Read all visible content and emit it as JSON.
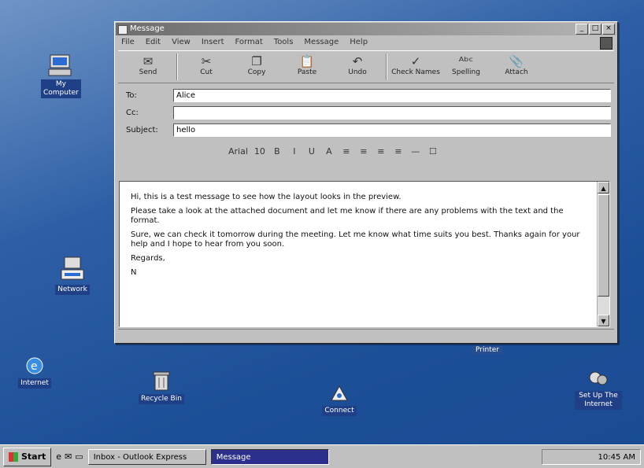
{
  "desktop": {
    "icons": [
      {
        "label": "My Computer",
        "glyph": "computer-icon"
      },
      {
        "label": "Network",
        "glyph": "network-icon"
      },
      {
        "label": "Internet",
        "glyph": "ie-icon"
      },
      {
        "label": "Recycle Bin",
        "glyph": "recycle-bin-icon"
      },
      {
        "label": "Connect",
        "glyph": "dialup-icon"
      },
      {
        "label": "Set Up The Internet",
        "glyph": "setup-icon"
      }
    ],
    "floating_tag": "Printer"
  },
  "window": {
    "title": "Message",
    "menu": [
      "File",
      "Edit",
      "View",
      "Insert",
      "Format",
      "Tools",
      "Message",
      "Help"
    ],
    "toolbar": [
      {
        "label": "Send",
        "icon": "send-icon"
      },
      {
        "label": "Cut",
        "icon": "cut-icon"
      },
      {
        "label": "Copy",
        "icon": "copy-icon"
      },
      {
        "label": "Paste",
        "icon": "paste-icon"
      },
      {
        "label": "Undo",
        "icon": "undo-icon"
      },
      {
        "label": "Check Names",
        "icon": "check-names-icon"
      },
      {
        "label": "Spelling",
        "icon": "spelling-icon"
      },
      {
        "label": "Attach",
        "icon": "attach-icon"
      }
    ],
    "fields": {
      "to_label": "To:",
      "to_value": "Alice",
      "cc_label": "Cc:",
      "cc_value": "",
      "subject_label": "Subject:",
      "subject_value": "hello"
    },
    "format_bar": {
      "font": "Arial",
      "size": "10",
      "buttons": [
        "B",
        "I",
        "U",
        "A",
        "≡",
        "≡",
        "≡",
        "≡",
        "—",
        "☐"
      ]
    },
    "body": {
      "line1": "Hi, this is a test message to see how the layout looks in the preview.",
      "line2": "Please take a look at the attached document and let me know if there are any problems with the text and the format.",
      "line3": "Sure, we can check it tomorrow during the meeting. Let me know what time suits you best. Thanks again for your help and I hope to hear from you soon.",
      "signature": "Regards,",
      "cursor_line": "N"
    }
  },
  "taskbar": {
    "start_label": "Start",
    "quick_icons": [
      "ie-icon",
      "outlook-icon",
      "desktop-icon"
    ],
    "tasks": [
      {
        "label": "Inbox - Outlook Express",
        "active": false
      },
      {
        "label": "Message",
        "active": true
      }
    ],
    "clock": "10:45 AM"
  }
}
